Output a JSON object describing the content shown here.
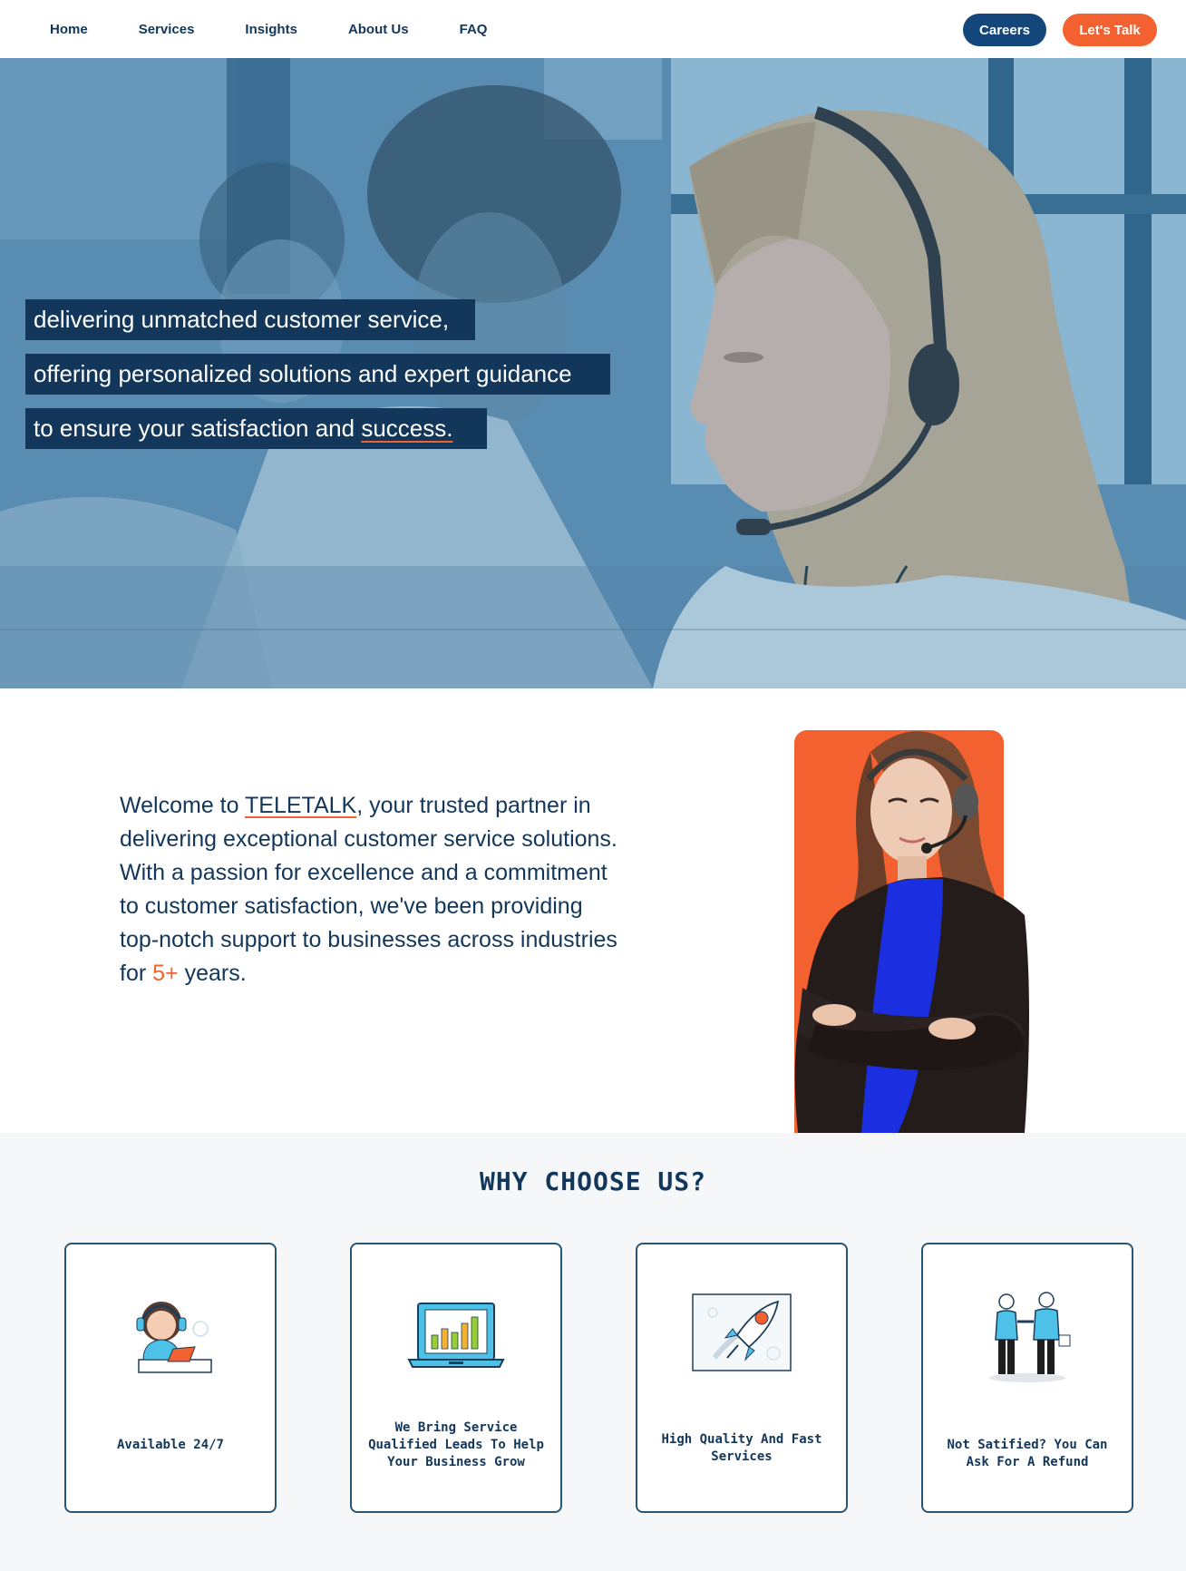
{
  "nav": {
    "links": [
      "Home",
      "Services",
      "Insights",
      "About Us",
      "FAQ"
    ],
    "careers": "Careers",
    "talk": "Let's Talk"
  },
  "hero": {
    "line1": "delivering unmatched customer service,",
    "line2": "offering personalized solutions and expert guidance",
    "line3_prefix": "to ensure your satisfaction and ",
    "line3_emph": "success."
  },
  "welcome": {
    "p1_a": "Welcome to ",
    "brand": "TELETALK",
    "p1_b": ", your trusted partner in delivering exceptional customer service solutions.",
    "p2_a": "With a passion for excellence and a commitment to customer satisfaction, we've been providing top-notch support to businesses across industries for ",
    "years": "5+",
    "p2_b": " years."
  },
  "why": {
    "title": "WHY CHOOSE US?",
    "cards": [
      {
        "label": "Available 24/7",
        "icon": "support-agent-icon"
      },
      {
        "label": "We Bring Service Qualified Leads To Help Your Business Grow",
        "icon": "laptop-chart-icon"
      },
      {
        "label": "High Quality And Fast Services",
        "icon": "rocket-icon"
      },
      {
        "label": "Not Satified? You Can Ask For A Refund",
        "icon": "handshake-icon"
      }
    ]
  },
  "colors": {
    "navy": "#13375a",
    "button_navy": "#13467a",
    "accent": "#f2612f"
  }
}
